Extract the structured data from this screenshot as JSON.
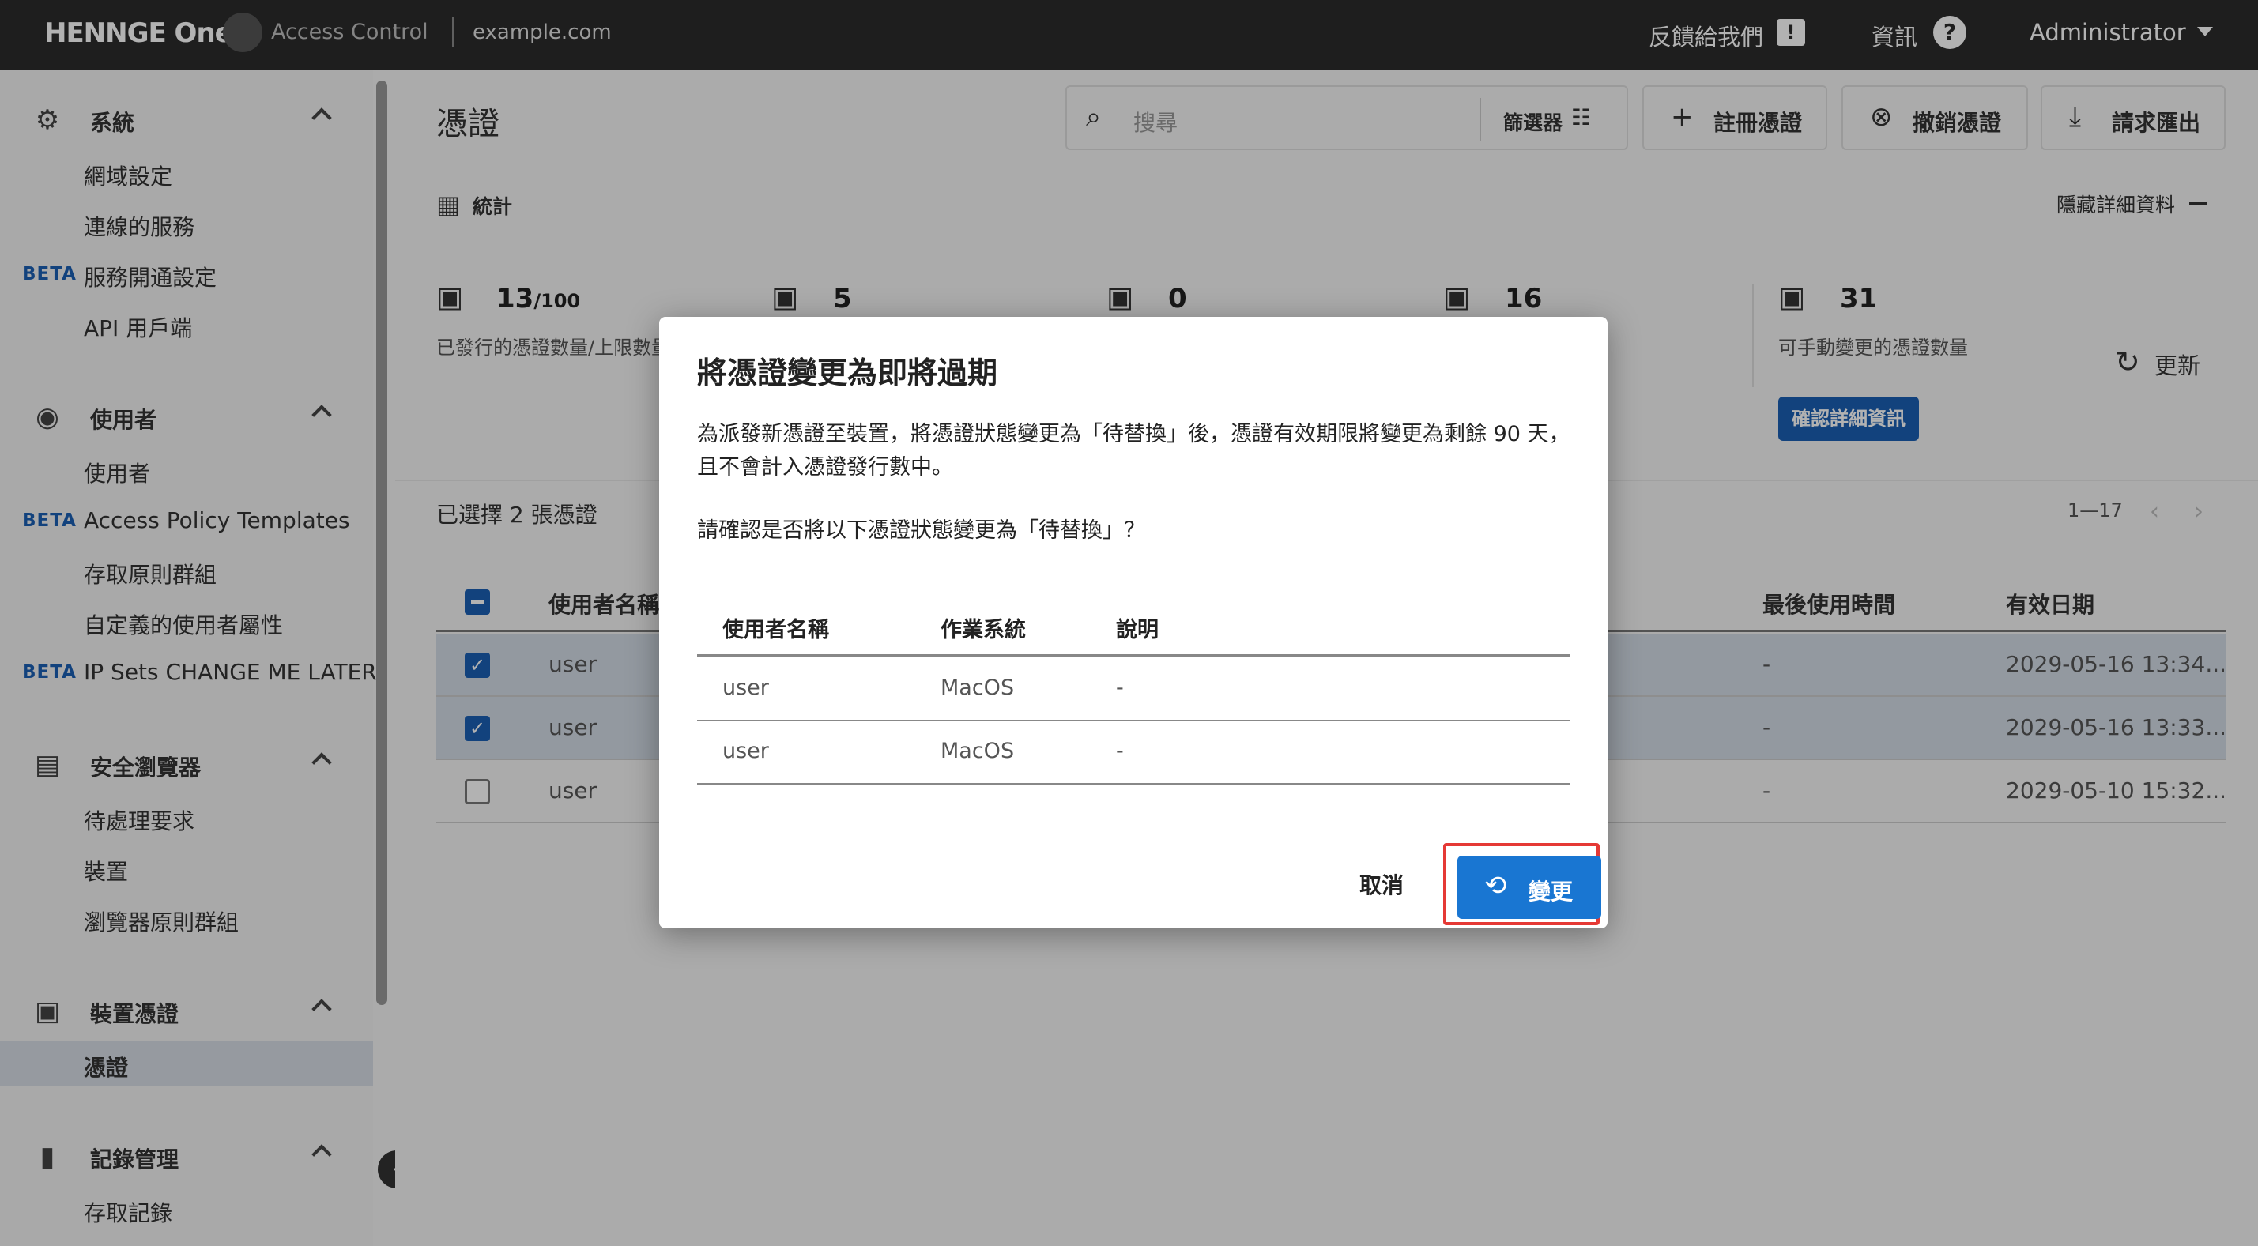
{
  "topbar": {
    "brand": "HENNGE One",
    "product": "Access Control",
    "domain": "example.com",
    "feedback": "反饋給我們",
    "info": "資訊",
    "admin": "Administrator"
  },
  "sidebar": {
    "sections": [
      {
        "label": "系統",
        "icon": "gear-icon"
      },
      {
        "label": "使用者",
        "icon": "user-circle-icon"
      },
      {
        "label": "安全瀏覽器",
        "icon": "browser-window-icon"
      },
      {
        "label": "裝置憑證",
        "icon": "certificate-icon"
      },
      {
        "label": "記錄管理",
        "icon": "bar-chart-icon"
      }
    ],
    "items": [
      {
        "label": "網域設定"
      },
      {
        "label": "連線的服務"
      },
      {
        "label": "服務開通設定",
        "badge": "BETA"
      },
      {
        "label": "API 用戶端"
      },
      {
        "label": "使用者"
      },
      {
        "label": "Access Policy Templates",
        "badge": "BETA"
      },
      {
        "label": "存取原則群組"
      },
      {
        "label": "自定義的使用者屬性"
      },
      {
        "label": "IP Sets CHANGE ME LATER",
        "badge": "BETA"
      },
      {
        "label": "待處理要求"
      },
      {
        "label": "裝置"
      },
      {
        "label": "瀏覽器原則群組"
      },
      {
        "label": "憑證"
      },
      {
        "label": "存取記錄"
      }
    ]
  },
  "main": {
    "title": "憑證",
    "search_placeholder": "搜尋",
    "filter_label": "篩選器",
    "buttons": {
      "register": "註冊憑證",
      "revoke": "撤銷憑證",
      "export": "請求匯出"
    },
    "stats_label": "統計",
    "hide_details": "隱藏詳細資料",
    "stats": [
      {
        "value": "13",
        "suffix": "/100",
        "label": "已發行的憑證數量/上限數量"
      },
      {
        "value": "5"
      },
      {
        "value": "0"
      },
      {
        "value": "16"
      },
      {
        "value": "31",
        "label": "可手動變更的憑證數量"
      }
    ],
    "confirm_details": "確認詳細資訊",
    "refresh": "更新",
    "selected_count": "已選擇 2 張憑證",
    "pagination": "1—17",
    "table": {
      "headers": [
        "使用者名稱",
        "最後使用時間",
        "有效日期"
      ],
      "rows": [
        {
          "user": "user",
          "last_used": "-",
          "valid_until": "2029-05-16 13:34...",
          "checked": true
        },
        {
          "user": "user",
          "last_used": "-",
          "valid_until": "2029-05-16 13:33...",
          "checked": true
        },
        {
          "user": "user",
          "last_used": "-",
          "valid_until": "2029-05-10 15:32...",
          "checked": false
        }
      ]
    }
  },
  "modal": {
    "title": "將憑證變更為即將過期",
    "body1": "為派發新憑證至裝置，將憑證狀態變更為「待替換」後，憑證有效期限將變更為剩餘 90 天，且不會計入憑證發行數中。",
    "body2": "請確認是否將以下憑證狀態變更為「待替換」？",
    "headers": [
      "使用者名稱",
      "作業系統",
      "說明"
    ],
    "rows": [
      {
        "user": "user",
        "os": "MacOS",
        "desc": "-"
      },
      {
        "user": "user",
        "os": "MacOS",
        "desc": "-"
      }
    ],
    "cancel": "取消",
    "change": "變更"
  },
  "colors": {
    "topbar": "#2b2b2b",
    "primary": "#1976d2",
    "highlight": "#e53935",
    "selected_row": "#d3dbe6"
  }
}
